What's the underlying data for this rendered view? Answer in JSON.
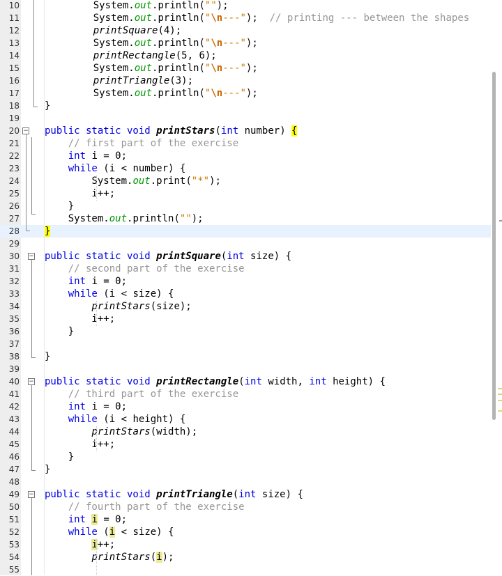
{
  "editor": {
    "lines": [
      {
        "n": "10",
        "t": [
          [
            "    ",
            ""
          ],
          [
            "System.",
            ""
          ],
          [
            "out",
            "fld"
          ],
          [
            ".println(",
            ""
          ],
          [
            "\"\"",
            "str"
          ],
          [
            ");",
            ""
          ]
        ]
      },
      {
        "n": "11",
        "t": [
          [
            "    ",
            ""
          ],
          [
            "System.",
            ""
          ],
          [
            "out",
            "fld"
          ],
          [
            ".println(",
            ""
          ],
          [
            "\"",
            "str"
          ],
          [
            "\\n",
            "esc"
          ],
          [
            "---\"",
            "str"
          ],
          [
            ");  ",
            ""
          ],
          [
            "// printing --- between the shapes",
            "cmt"
          ]
        ]
      },
      {
        "n": "12",
        "t": [
          [
            "    ",
            ""
          ],
          [
            "printSquare",
            "mth"
          ],
          [
            "(4);",
            ""
          ]
        ]
      },
      {
        "n": "13",
        "t": [
          [
            "    ",
            ""
          ],
          [
            "System.",
            ""
          ],
          [
            "out",
            "fld"
          ],
          [
            ".println(",
            ""
          ],
          [
            "\"",
            "str"
          ],
          [
            "\\n",
            "esc"
          ],
          [
            "---\"",
            "str"
          ],
          [
            ");",
            ""
          ]
        ]
      },
      {
        "n": "14",
        "t": [
          [
            "    ",
            ""
          ],
          [
            "printRectangle",
            "mth"
          ],
          [
            "(5, 6);",
            ""
          ]
        ]
      },
      {
        "n": "15",
        "t": [
          [
            "    ",
            ""
          ],
          [
            "System.",
            ""
          ],
          [
            "out",
            "fld"
          ],
          [
            ".println(",
            ""
          ],
          [
            "\"",
            "str"
          ],
          [
            "\\n",
            "esc"
          ],
          [
            "---\"",
            "str"
          ],
          [
            ");",
            ""
          ]
        ]
      },
      {
        "n": "16",
        "t": [
          [
            "    ",
            ""
          ],
          [
            "printTriangle",
            "mth"
          ],
          [
            "(3);",
            ""
          ]
        ]
      },
      {
        "n": "17",
        "t": [
          [
            "    ",
            ""
          ],
          [
            "System.",
            ""
          ],
          [
            "out",
            "fld"
          ],
          [
            ".println(",
            ""
          ],
          [
            "\"",
            "str"
          ],
          [
            "\\n",
            "esc"
          ],
          [
            "---\"",
            "str"
          ],
          [
            ");",
            ""
          ]
        ]
      },
      {
        "n": "18",
        "t": [
          [
            "}",
            ""
          ]
        ]
      },
      {
        "n": "19",
        "t": []
      },
      {
        "n": "20",
        "t": [
          [
            "public static void ",
            "kw"
          ],
          [
            "printStars",
            "decl"
          ],
          [
            "(",
            ""
          ],
          [
            "int",
            "kw"
          ],
          [
            " number) ",
            ""
          ],
          [
            "{",
            "hlb"
          ]
        ]
      },
      {
        "n": "21",
        "t": [
          [
            "    ",
            ""
          ],
          [
            "// first part of the exercise",
            "cmt"
          ]
        ]
      },
      {
        "n": "22",
        "t": [
          [
            "    ",
            ""
          ],
          [
            "int",
            "kw"
          ],
          [
            " i = 0;",
            ""
          ]
        ]
      },
      {
        "n": "23",
        "t": [
          [
            "    ",
            ""
          ],
          [
            "while",
            "kw"
          ],
          [
            " (i < number) {",
            ""
          ]
        ]
      },
      {
        "n": "24",
        "t": [
          [
            "        ",
            ""
          ],
          [
            "System.",
            ""
          ],
          [
            "out",
            "fld"
          ],
          [
            ".print(",
            ""
          ],
          [
            "\"*\"",
            "str"
          ],
          [
            ");",
            ""
          ]
        ]
      },
      {
        "n": "25",
        "t": [
          [
            "        i++;",
            ""
          ]
        ]
      },
      {
        "n": "26",
        "t": [
          [
            "    }",
            ""
          ]
        ]
      },
      {
        "n": "27",
        "t": [
          [
            "    ",
            ""
          ],
          [
            "System.",
            ""
          ],
          [
            "out",
            "fld"
          ],
          [
            ".println(",
            ""
          ],
          [
            "\"\"",
            "str"
          ],
          [
            ");",
            ""
          ]
        ]
      },
      {
        "n": "28",
        "t": [
          [
            "}",
            "hlb"
          ]
        ],
        "cur": true
      },
      {
        "n": "29",
        "t": []
      },
      {
        "n": "30",
        "t": [
          [
            "public static void ",
            "kw"
          ],
          [
            "printSquare",
            "decl"
          ],
          [
            "(",
            ""
          ],
          [
            "int",
            "kw"
          ],
          [
            " size) {",
            ""
          ]
        ]
      },
      {
        "n": "31",
        "t": [
          [
            "    ",
            ""
          ],
          [
            "// second part of the exercise",
            "cmt"
          ]
        ]
      },
      {
        "n": "32",
        "t": [
          [
            "    ",
            ""
          ],
          [
            "int",
            "kw"
          ],
          [
            " i = 0;",
            ""
          ]
        ]
      },
      {
        "n": "33",
        "t": [
          [
            "    ",
            ""
          ],
          [
            "while",
            "kw"
          ],
          [
            " (i < size) {",
            ""
          ]
        ]
      },
      {
        "n": "34",
        "t": [
          [
            "        ",
            ""
          ],
          [
            "printStars",
            "mth"
          ],
          [
            "(size);",
            ""
          ]
        ]
      },
      {
        "n": "35",
        "t": [
          [
            "        i++;",
            ""
          ]
        ]
      },
      {
        "n": "36",
        "t": [
          [
            "    }",
            ""
          ]
        ]
      },
      {
        "n": "37",
        "t": []
      },
      {
        "n": "38",
        "t": [
          [
            "}",
            ""
          ]
        ]
      },
      {
        "n": "39",
        "t": []
      },
      {
        "n": "40",
        "t": [
          [
            "public static void ",
            "kw"
          ],
          [
            "printRectangle",
            "decl"
          ],
          [
            "(",
            ""
          ],
          [
            "int",
            "kw"
          ],
          [
            " width, ",
            ""
          ],
          [
            "int",
            "kw"
          ],
          [
            " height) {",
            ""
          ]
        ]
      },
      {
        "n": "41",
        "t": [
          [
            "    ",
            ""
          ],
          [
            "// third part of the exercise",
            "cmt"
          ]
        ]
      },
      {
        "n": "42",
        "t": [
          [
            "    ",
            ""
          ],
          [
            "int",
            "kw"
          ],
          [
            " i = 0;",
            ""
          ]
        ]
      },
      {
        "n": "43",
        "t": [
          [
            "    ",
            ""
          ],
          [
            "while",
            "kw"
          ],
          [
            " (i < height) {",
            ""
          ]
        ]
      },
      {
        "n": "44",
        "t": [
          [
            "        ",
            ""
          ],
          [
            "printStars",
            "mth"
          ],
          [
            "(width);",
            ""
          ]
        ]
      },
      {
        "n": "45",
        "t": [
          [
            "        i++;",
            ""
          ]
        ]
      },
      {
        "n": "46",
        "t": [
          [
            "    }",
            ""
          ]
        ]
      },
      {
        "n": "47",
        "t": [
          [
            "}",
            ""
          ]
        ]
      },
      {
        "n": "48",
        "t": []
      },
      {
        "n": "49",
        "t": [
          [
            "public static void ",
            "kw"
          ],
          [
            "printTriangle",
            "decl"
          ],
          [
            "(",
            ""
          ],
          [
            "int",
            "kw"
          ],
          [
            " size) {",
            ""
          ]
        ]
      },
      {
        "n": "50",
        "t": [
          [
            "    ",
            ""
          ],
          [
            "// fourth part of the exercise",
            "cmt"
          ]
        ]
      },
      {
        "n": "51",
        "t": [
          [
            "    ",
            ""
          ],
          [
            "int",
            "kw"
          ],
          [
            " ",
            ""
          ],
          [
            "i",
            "hlv"
          ],
          [
            " = 0;",
            ""
          ]
        ]
      },
      {
        "n": "52",
        "t": [
          [
            "    ",
            ""
          ],
          [
            "while",
            "kw"
          ],
          [
            " (",
            ""
          ],
          [
            "i",
            "hlv"
          ],
          [
            " < size) {",
            ""
          ]
        ]
      },
      {
        "n": "53",
        "t": [
          [
            "        ",
            ""
          ],
          [
            "i",
            "hlv"
          ],
          [
            "++;",
            ""
          ]
        ]
      },
      {
        "n": "54",
        "t": [
          [
            "        ",
            ""
          ],
          [
            "printStars",
            "mth"
          ],
          [
            "(",
            ""
          ],
          [
            "i",
            "hlv"
          ],
          [
            ");",
            ""
          ]
        ]
      },
      {
        "n": "55",
        "t": []
      }
    ]
  }
}
